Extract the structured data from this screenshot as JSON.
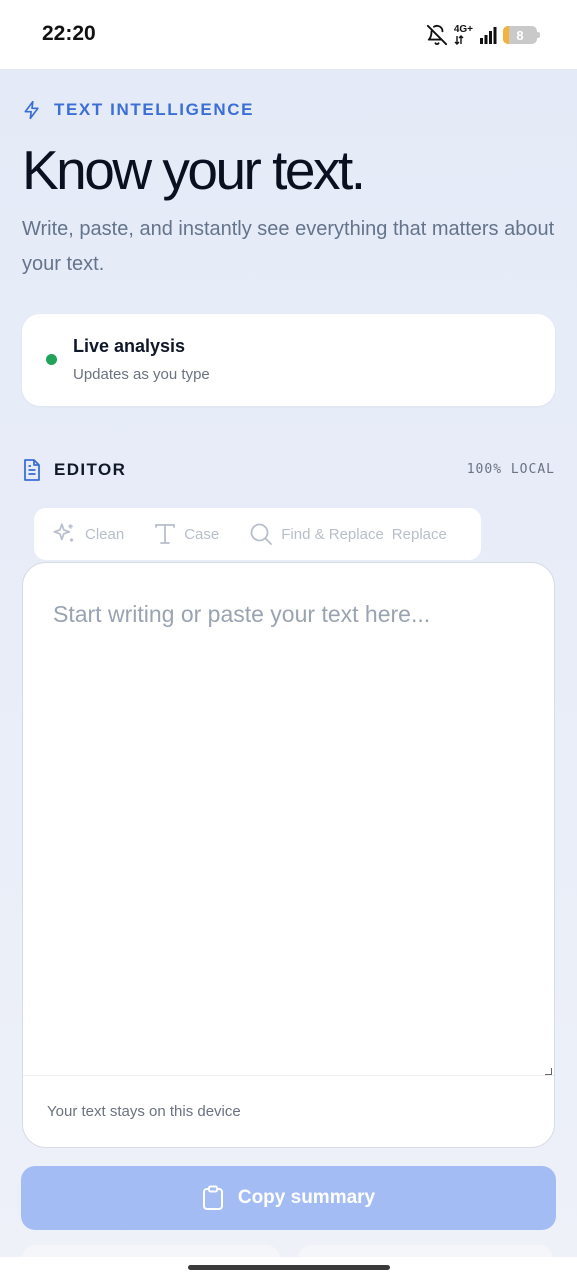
{
  "status_bar": {
    "time": "22:20",
    "network": "4G+",
    "battery": "8"
  },
  "hero": {
    "eyebrow": "TEXT INTELLIGENCE",
    "title": "Know your text.",
    "subtitle": "Write, paste, and instantly see everything that matters about your text."
  },
  "live_card": {
    "title": "Live analysis",
    "subtitle": "Updates as you type",
    "dot_color": "#22a35a"
  },
  "editor": {
    "title": "EDITOR",
    "badge": "100% LOCAL",
    "placeholder": "Start writing or paste your text here...",
    "footer": "Your text stays on this device"
  },
  "toolbar": {
    "clean_label": "Clean",
    "case_label": "Case",
    "find_replace_label": "Find & Replace",
    "replace_label": "Replace"
  },
  "actions": {
    "copy_summary": "Copy summary"
  },
  "colors": {
    "accent": "#3b6fd6",
    "button_disabled": "#a3bdf4"
  }
}
